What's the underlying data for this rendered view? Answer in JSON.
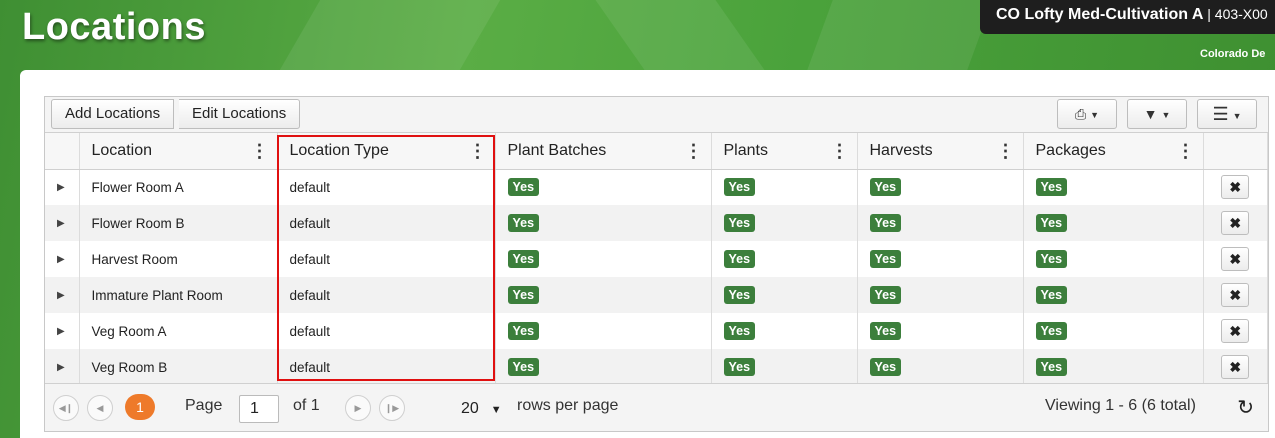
{
  "header": {
    "title": "Locations",
    "facility_name": "CO Lofty Med-Cultivation A",
    "facility_license": "| 403-X00",
    "state": "Colorado De"
  },
  "toolbar": {
    "add_label": "Add Locations",
    "edit_label": "Edit Locations",
    "print_icon": "print-icon",
    "filter_icon": "filter-icon",
    "menu_icon": "menu-icon"
  },
  "columns": [
    "Location",
    "Location Type",
    "Plant Batches",
    "Plants",
    "Harvests",
    "Packages"
  ],
  "rows": [
    {
      "location": "Flower Room A",
      "type": "default",
      "plant_batches": "Yes",
      "plants": "Yes",
      "harvests": "Yes",
      "packages": "Yes"
    },
    {
      "location": "Flower Room B",
      "type": "default",
      "plant_batches": "Yes",
      "plants": "Yes",
      "harvests": "Yes",
      "packages": "Yes"
    },
    {
      "location": "Harvest Room",
      "type": "default",
      "plant_batches": "Yes",
      "plants": "Yes",
      "harvests": "Yes",
      "packages": "Yes"
    },
    {
      "location": "Immature Plant Room",
      "type": "default",
      "plant_batches": "Yes",
      "plants": "Yes",
      "harvests": "Yes",
      "packages": "Yes"
    },
    {
      "location": "Veg Room A",
      "type": "default",
      "plant_batches": "Yes",
      "plants": "Yes",
      "harvests": "Yes",
      "packages": "Yes"
    },
    {
      "location": "Veg Room B",
      "type": "default",
      "plant_batches": "Yes",
      "plants": "Yes",
      "harvests": "Yes",
      "packages": "Yes"
    }
  ],
  "pager": {
    "current_page_badge": "1",
    "page_label": "Page",
    "page_value": "1",
    "of_label": "of 1",
    "rows_per_page": "20",
    "rows_label": "rows per page",
    "viewing": "Viewing 1 - 6 (6 total)"
  },
  "colors": {
    "yes_badge": "#3c7f3c",
    "highlight": "#e01010",
    "page_badge": "#ee7a2a"
  }
}
